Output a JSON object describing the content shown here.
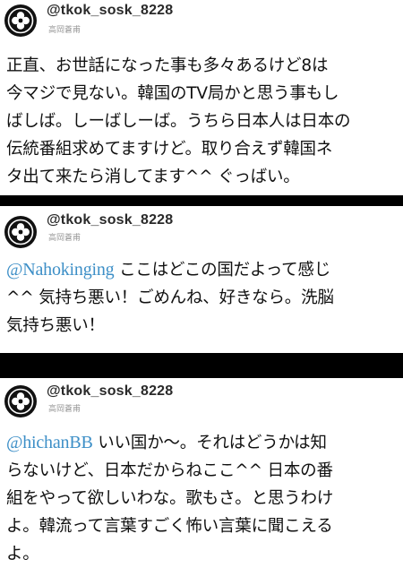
{
  "tweets": [
    {
      "handle": "@tkok_sosk_8228",
      "display_name": "高岡蒼甫",
      "lines": [
        "正直、お世話になった事も多々あるけど8は",
        "今マジで見ない。韓国のTV局かと思う事もし",
        "ばしば。しーばしーば。うちら日本人は日本の",
        "伝統番組求めてますけど。取り合えず韓国ネ",
        "タ出て来たら消してます^^ ぐっばい。"
      ]
    },
    {
      "handle": "@tkok_sosk_8228",
      "display_name": "高岡蒼甫",
      "mention": "@Nahokinging",
      "lines": [
        " ここはどこの国だよって感じ",
        "^^ 気持ち悪い！ごめんね、好きなら。洗脳",
        "気持ち悪い！"
      ]
    },
    {
      "handle": "@tkok_sosk_8228",
      "display_name": "高岡蒼甫",
      "mention": "@hichanBB",
      "lines": [
        " いい国か～。それはどうかは知",
        "らないけど、日本だからねここ^^ 日本の番",
        "組をやって欲しいわな。歌もさ。と思うわけ",
        "よ。韓流って言葉すごく怖い言葉に聞こえる",
        "よ。"
      ]
    }
  ],
  "colors": {
    "mention": "#3d8fc7",
    "separator": "#000000",
    "handle": "#2a2a2a",
    "display_name": "#9a9a9a"
  },
  "icons": [
    "crest-avatar-icon"
  ]
}
